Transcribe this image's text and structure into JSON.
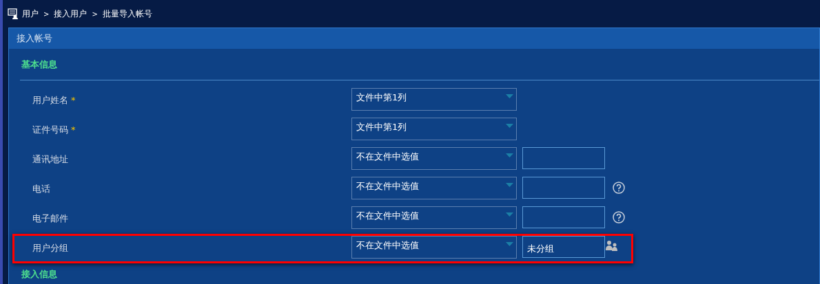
{
  "breadcrumb": [
    {
      "label": "用户"
    },
    {
      "separator": ">",
      "label": "接入用户"
    },
    {
      "separator": ">",
      "label": "批量导入帐号"
    }
  ],
  "panel": {
    "title": "接入帐号"
  },
  "sections": [
    {
      "title": "基本信息",
      "rows": [
        {
          "kind": "select",
          "label": "用户姓名",
          "required_mark": "*",
          "select": "文件中第1列",
          "highlighted": false
        },
        {
          "kind": "select",
          "label": "证件号码",
          "required_mark": "*",
          "select": "文件中第1列",
          "highlighted": false
        },
        {
          "kind": "input",
          "label": "通讯地址",
          "select": "不在文件中选值",
          "highlighted": false
        },
        {
          "kind": "input-help",
          "label": "电话",
          "select": "不在文件中选值",
          "highlighted": false
        },
        {
          "kind": "input-help",
          "label": "电子邮件",
          "select": "不在文件中选值",
          "highlighted": false
        },
        {
          "kind": "group",
          "label": "用户分组",
          "select": "不在文件中选值",
          "value": "未分组",
          "highlighted": true
        }
      ]
    },
    {
      "title": "接入信息"
    }
  ]
}
